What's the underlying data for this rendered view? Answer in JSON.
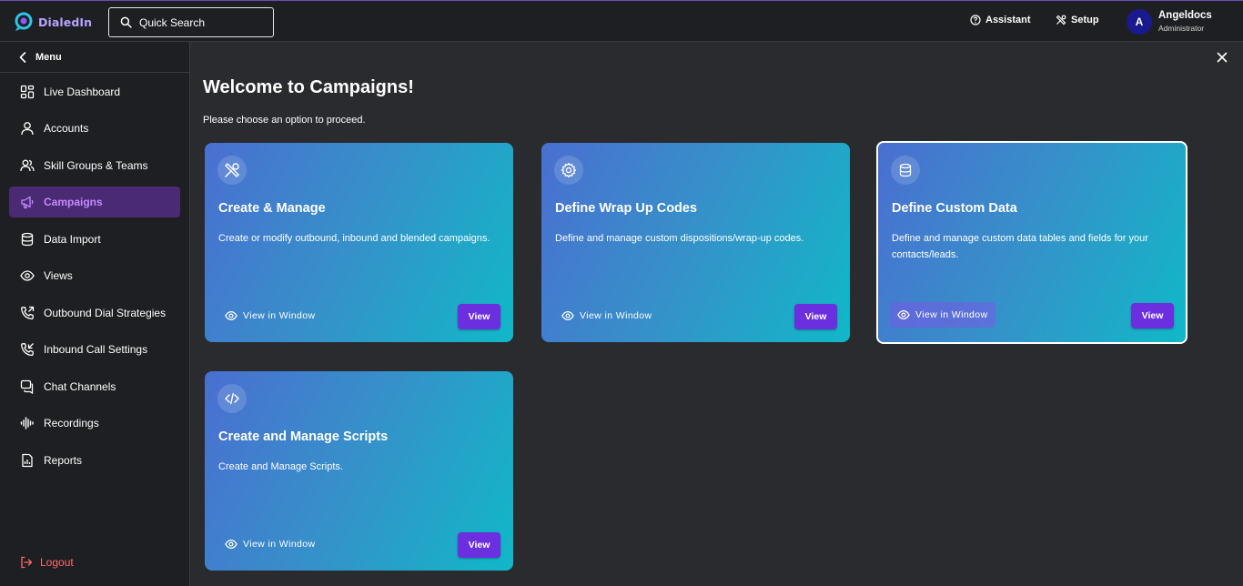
{
  "app": {
    "logo_text": "DialedIn"
  },
  "search": {
    "label": "Quick Search"
  },
  "topbar": {
    "assistant_label": "Assistant",
    "setup_label": "Setup",
    "user": {
      "avatar_letter": "A",
      "name": "Angeldocs",
      "role": "Administrator"
    }
  },
  "sidebar": {
    "menu_label": "Menu",
    "items": [
      {
        "label": "Live Dashboard",
        "icon": "dashboard-icon"
      },
      {
        "label": "Accounts",
        "icon": "user-icon"
      },
      {
        "label": "Skill Groups & Teams",
        "icon": "users-icon"
      },
      {
        "label": "Campaigns",
        "icon": "megaphone-icon",
        "active": true
      },
      {
        "label": "Data Import",
        "icon": "database-icon"
      },
      {
        "label": "Views",
        "icon": "eye-icon"
      },
      {
        "label": "Outbound Dial Strategies",
        "icon": "phone-outgoing-icon"
      },
      {
        "label": "Inbound Call Settings",
        "icon": "phone-incoming-icon"
      },
      {
        "label": "Chat Channels",
        "icon": "chat-icon"
      },
      {
        "label": "Recordings",
        "icon": "audio-waveform-icon"
      },
      {
        "label": "Reports",
        "icon": "report-icon"
      }
    ],
    "logout_label": "Logout"
  },
  "main": {
    "title": "Welcome to Campaigns!",
    "subtitle": "Please choose an option to proceed.",
    "cards": [
      {
        "title": "Create & Manage",
        "description": "Create or modify outbound, inbound and blended campaigns.",
        "icon": "tools-icon",
        "view_window_label": "View in Window",
        "view_label": "View"
      },
      {
        "title": "Define Wrap Up Codes",
        "description": "Define and manage custom dispositions/wrap-up codes.",
        "icon": "gear-icon",
        "view_window_label": "View in Window",
        "view_label": "View"
      },
      {
        "title": "Define Custom Data",
        "description": "Define and manage custom data tables and fields for your contacts/leads.",
        "icon": "database-icon",
        "view_window_label": "View in Window",
        "view_label": "View",
        "selected": true
      },
      {
        "title": "Create and Manage Scripts",
        "description": "Create and Manage Scripts.",
        "icon": "code-icon",
        "view_window_label": "View in Window",
        "view_label": "View"
      }
    ]
  },
  "colors": {
    "accent": "#6b2fe0",
    "active_nav_bg": "#4a2a72",
    "active_nav_text": "#c48bff",
    "logout": "#ff6b6b",
    "card_gradient_start": "#4a6fd1",
    "card_gradient_end": "#10b8c8"
  }
}
